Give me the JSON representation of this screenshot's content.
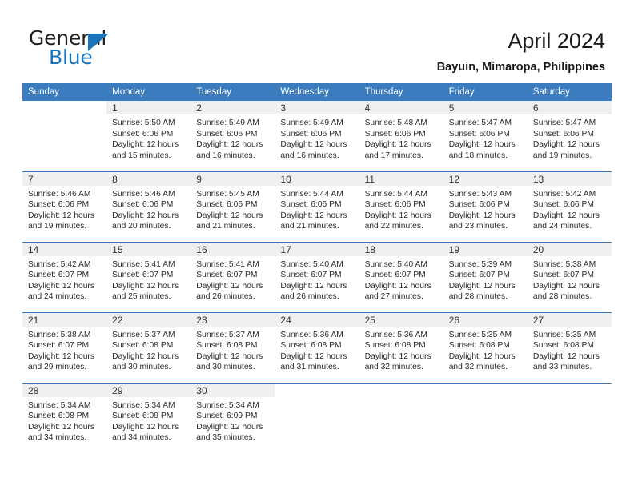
{
  "brand": {
    "name_part1": "General",
    "name_part2": "Blue",
    "accent_color": "#1b75bb"
  },
  "header": {
    "title": "April 2024",
    "subtitle": "Bayuin, Mimaropa, Philippines"
  },
  "calendar": {
    "header_bg": "#3a7cbe",
    "daynum_bg": "#efefef",
    "weekdays": [
      "Sunday",
      "Monday",
      "Tuesday",
      "Wednesday",
      "Thursday",
      "Friday",
      "Saturday"
    ],
    "weeks": [
      [
        {
          "day": "",
          "sunrise": "",
          "sunset": "",
          "daylight_line1": "",
          "daylight_line2": ""
        },
        {
          "day": "1",
          "sunrise": "Sunrise: 5:50 AM",
          "sunset": "Sunset: 6:06 PM",
          "daylight_line1": "Daylight: 12 hours",
          "daylight_line2": "and 15 minutes."
        },
        {
          "day": "2",
          "sunrise": "Sunrise: 5:49 AM",
          "sunset": "Sunset: 6:06 PM",
          "daylight_line1": "Daylight: 12 hours",
          "daylight_line2": "and 16 minutes."
        },
        {
          "day": "3",
          "sunrise": "Sunrise: 5:49 AM",
          "sunset": "Sunset: 6:06 PM",
          "daylight_line1": "Daylight: 12 hours",
          "daylight_line2": "and 16 minutes."
        },
        {
          "day": "4",
          "sunrise": "Sunrise: 5:48 AM",
          "sunset": "Sunset: 6:06 PM",
          "daylight_line1": "Daylight: 12 hours",
          "daylight_line2": "and 17 minutes."
        },
        {
          "day": "5",
          "sunrise": "Sunrise: 5:47 AM",
          "sunset": "Sunset: 6:06 PM",
          "daylight_line1": "Daylight: 12 hours",
          "daylight_line2": "and 18 minutes."
        },
        {
          "day": "6",
          "sunrise": "Sunrise: 5:47 AM",
          "sunset": "Sunset: 6:06 PM",
          "daylight_line1": "Daylight: 12 hours",
          "daylight_line2": "and 19 minutes."
        }
      ],
      [
        {
          "day": "7",
          "sunrise": "Sunrise: 5:46 AM",
          "sunset": "Sunset: 6:06 PM",
          "daylight_line1": "Daylight: 12 hours",
          "daylight_line2": "and 19 minutes."
        },
        {
          "day": "8",
          "sunrise": "Sunrise: 5:46 AM",
          "sunset": "Sunset: 6:06 PM",
          "daylight_line1": "Daylight: 12 hours",
          "daylight_line2": "and 20 minutes."
        },
        {
          "day": "9",
          "sunrise": "Sunrise: 5:45 AM",
          "sunset": "Sunset: 6:06 PM",
          "daylight_line1": "Daylight: 12 hours",
          "daylight_line2": "and 21 minutes."
        },
        {
          "day": "10",
          "sunrise": "Sunrise: 5:44 AM",
          "sunset": "Sunset: 6:06 PM",
          "daylight_line1": "Daylight: 12 hours",
          "daylight_line2": "and 21 minutes."
        },
        {
          "day": "11",
          "sunrise": "Sunrise: 5:44 AM",
          "sunset": "Sunset: 6:06 PM",
          "daylight_line1": "Daylight: 12 hours",
          "daylight_line2": "and 22 minutes."
        },
        {
          "day": "12",
          "sunrise": "Sunrise: 5:43 AM",
          "sunset": "Sunset: 6:06 PM",
          "daylight_line1": "Daylight: 12 hours",
          "daylight_line2": "and 23 minutes."
        },
        {
          "day": "13",
          "sunrise": "Sunrise: 5:42 AM",
          "sunset": "Sunset: 6:06 PM",
          "daylight_line1": "Daylight: 12 hours",
          "daylight_line2": "and 24 minutes."
        }
      ],
      [
        {
          "day": "14",
          "sunrise": "Sunrise: 5:42 AM",
          "sunset": "Sunset: 6:07 PM",
          "daylight_line1": "Daylight: 12 hours",
          "daylight_line2": "and 24 minutes."
        },
        {
          "day": "15",
          "sunrise": "Sunrise: 5:41 AM",
          "sunset": "Sunset: 6:07 PM",
          "daylight_line1": "Daylight: 12 hours",
          "daylight_line2": "and 25 minutes."
        },
        {
          "day": "16",
          "sunrise": "Sunrise: 5:41 AM",
          "sunset": "Sunset: 6:07 PM",
          "daylight_line1": "Daylight: 12 hours",
          "daylight_line2": "and 26 minutes."
        },
        {
          "day": "17",
          "sunrise": "Sunrise: 5:40 AM",
          "sunset": "Sunset: 6:07 PM",
          "daylight_line1": "Daylight: 12 hours",
          "daylight_line2": "and 26 minutes."
        },
        {
          "day": "18",
          "sunrise": "Sunrise: 5:40 AM",
          "sunset": "Sunset: 6:07 PM",
          "daylight_line1": "Daylight: 12 hours",
          "daylight_line2": "and 27 minutes."
        },
        {
          "day": "19",
          "sunrise": "Sunrise: 5:39 AM",
          "sunset": "Sunset: 6:07 PM",
          "daylight_line1": "Daylight: 12 hours",
          "daylight_line2": "and 28 minutes."
        },
        {
          "day": "20",
          "sunrise": "Sunrise: 5:38 AM",
          "sunset": "Sunset: 6:07 PM",
          "daylight_line1": "Daylight: 12 hours",
          "daylight_line2": "and 28 minutes."
        }
      ],
      [
        {
          "day": "21",
          "sunrise": "Sunrise: 5:38 AM",
          "sunset": "Sunset: 6:07 PM",
          "daylight_line1": "Daylight: 12 hours",
          "daylight_line2": "and 29 minutes."
        },
        {
          "day": "22",
          "sunrise": "Sunrise: 5:37 AM",
          "sunset": "Sunset: 6:08 PM",
          "daylight_line1": "Daylight: 12 hours",
          "daylight_line2": "and 30 minutes."
        },
        {
          "day": "23",
          "sunrise": "Sunrise: 5:37 AM",
          "sunset": "Sunset: 6:08 PM",
          "daylight_line1": "Daylight: 12 hours",
          "daylight_line2": "and 30 minutes."
        },
        {
          "day": "24",
          "sunrise": "Sunrise: 5:36 AM",
          "sunset": "Sunset: 6:08 PM",
          "daylight_line1": "Daylight: 12 hours",
          "daylight_line2": "and 31 minutes."
        },
        {
          "day": "25",
          "sunrise": "Sunrise: 5:36 AM",
          "sunset": "Sunset: 6:08 PM",
          "daylight_line1": "Daylight: 12 hours",
          "daylight_line2": "and 32 minutes."
        },
        {
          "day": "26",
          "sunrise": "Sunrise: 5:35 AM",
          "sunset": "Sunset: 6:08 PM",
          "daylight_line1": "Daylight: 12 hours",
          "daylight_line2": "and 32 minutes."
        },
        {
          "day": "27",
          "sunrise": "Sunrise: 5:35 AM",
          "sunset": "Sunset: 6:08 PM",
          "daylight_line1": "Daylight: 12 hours",
          "daylight_line2": "and 33 minutes."
        }
      ],
      [
        {
          "day": "28",
          "sunrise": "Sunrise: 5:34 AM",
          "sunset": "Sunset: 6:08 PM",
          "daylight_line1": "Daylight: 12 hours",
          "daylight_line2": "and 34 minutes."
        },
        {
          "day": "29",
          "sunrise": "Sunrise: 5:34 AM",
          "sunset": "Sunset: 6:09 PM",
          "daylight_line1": "Daylight: 12 hours",
          "daylight_line2": "and 34 minutes."
        },
        {
          "day": "30",
          "sunrise": "Sunrise: 5:34 AM",
          "sunset": "Sunset: 6:09 PM",
          "daylight_line1": "Daylight: 12 hours",
          "daylight_line2": "and 35 minutes."
        },
        {
          "day": "",
          "sunrise": "",
          "sunset": "",
          "daylight_line1": "",
          "daylight_line2": ""
        },
        {
          "day": "",
          "sunrise": "",
          "sunset": "",
          "daylight_line1": "",
          "daylight_line2": ""
        },
        {
          "day": "",
          "sunrise": "",
          "sunset": "",
          "daylight_line1": "",
          "daylight_line2": ""
        },
        {
          "day": "",
          "sunrise": "",
          "sunset": "",
          "daylight_line1": "",
          "daylight_line2": ""
        }
      ]
    ]
  }
}
